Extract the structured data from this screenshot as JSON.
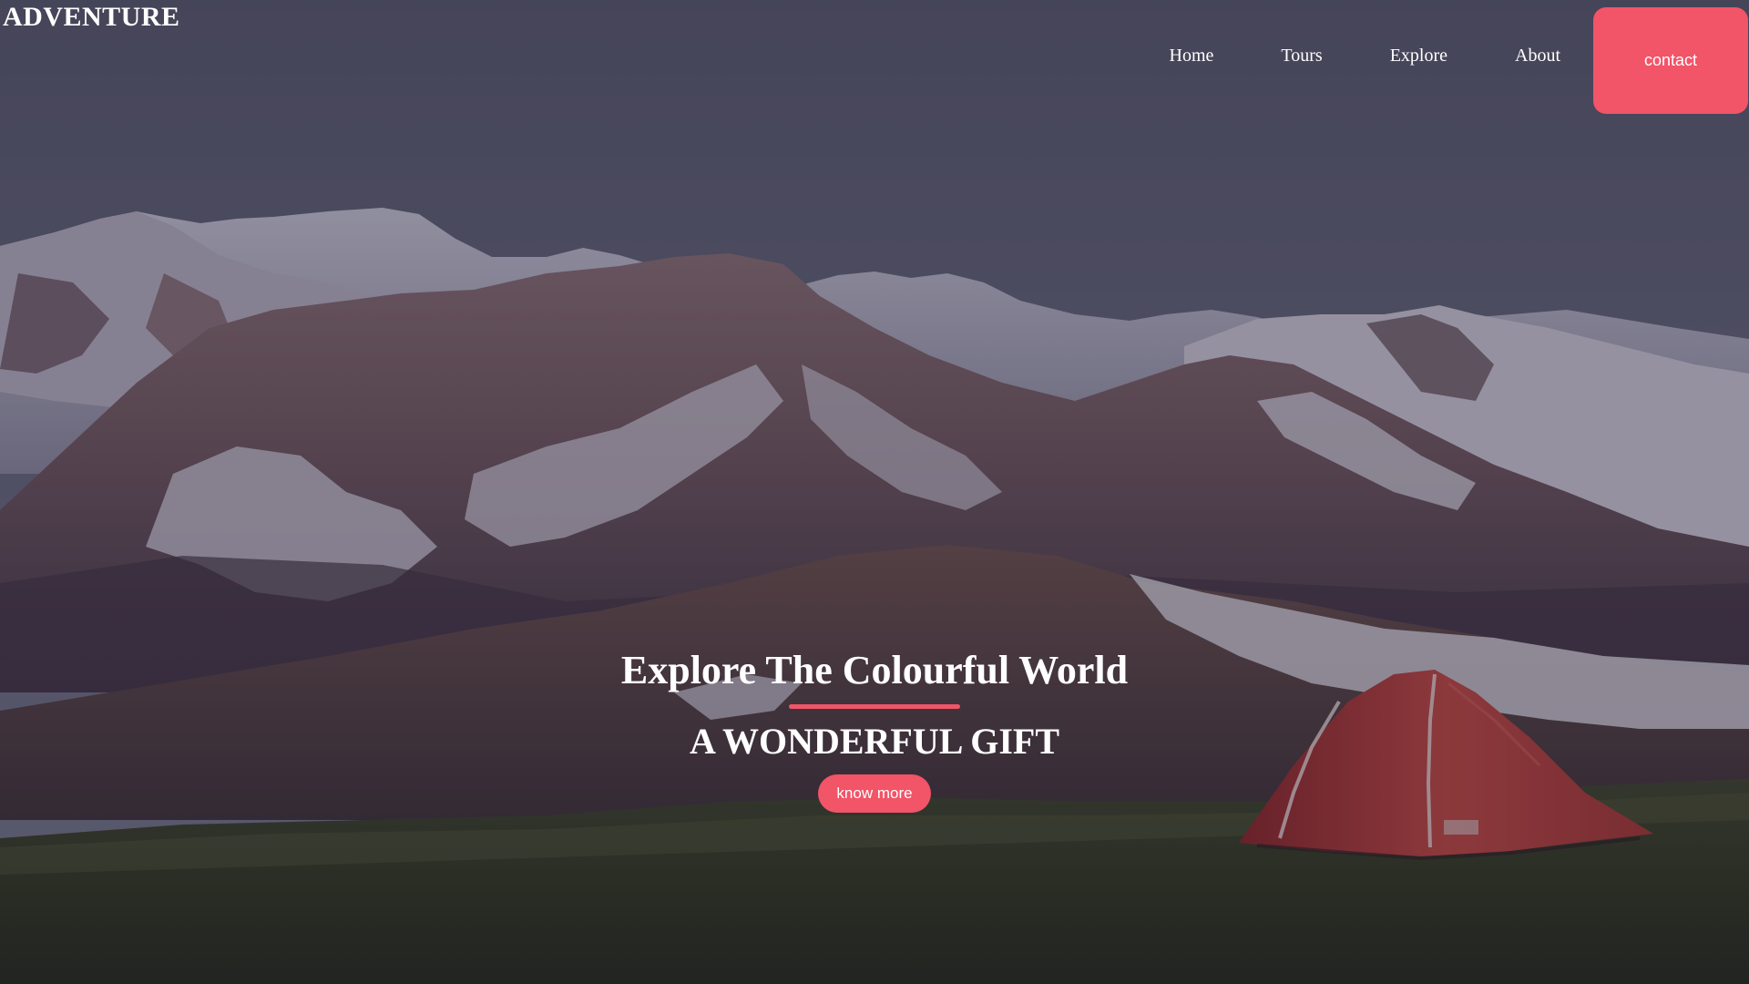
{
  "header": {
    "brand": "ADVENTURE",
    "nav": [
      {
        "label": "Home"
      },
      {
        "label": "Tours"
      },
      {
        "label": "Explore"
      },
      {
        "label": "About"
      }
    ],
    "contact_label": "contact"
  },
  "hero": {
    "title": "Explore The Colourful World",
    "subtitle": "A WONDERFUL GIFT",
    "cta_label": "know more"
  },
  "colors": {
    "accent": "#f25468",
    "text": "#ffffff"
  }
}
